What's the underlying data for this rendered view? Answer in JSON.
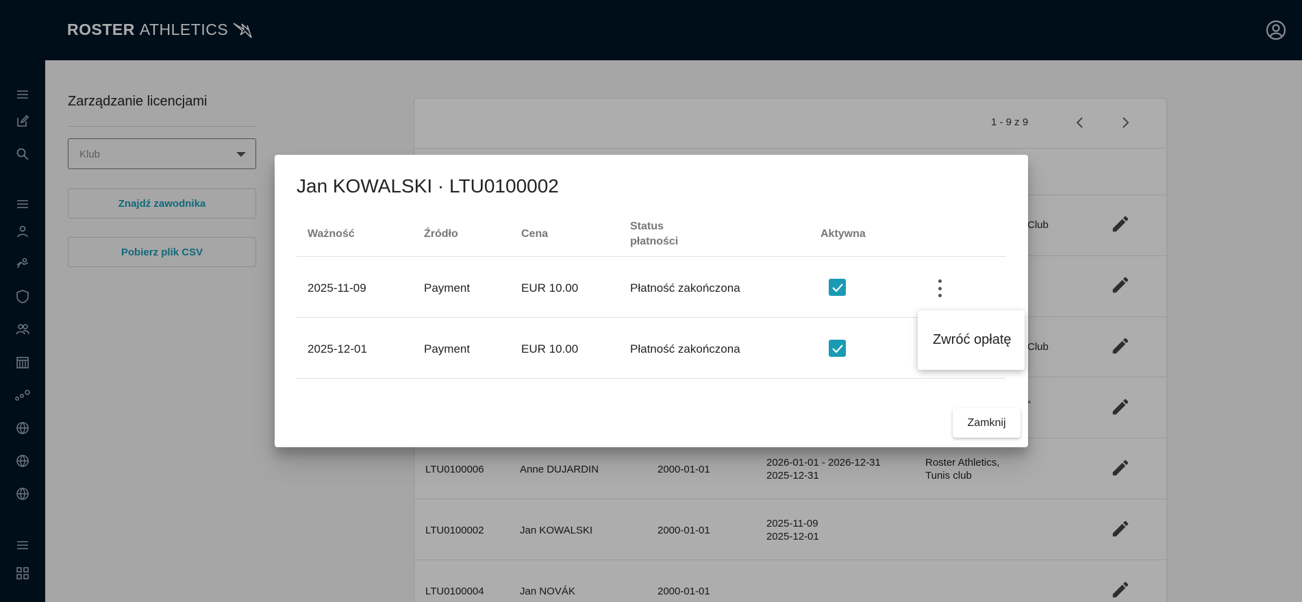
{
  "app": {
    "logo_bold": "ROSTER",
    "logo_light": "ATHLETICS",
    "account_icon": "account-circle-icon"
  },
  "rail": {
    "icons": [
      "menu-icon",
      "edit-icon",
      "search-icon",
      "menu-icon",
      "person-icon",
      "runner-icon",
      "shield-icon",
      "group-icon",
      "calendar-icon",
      "steps-icon",
      "globe-icon",
      "globe-icon",
      "globe-icon",
      "menu-icon",
      "grid-icon"
    ]
  },
  "panel": {
    "title": "Zarządzanie licencjami",
    "club_placeholder": "Klub",
    "find_button": "Znajdź zawodnika",
    "csv_button": "Pobierz plik CSV"
  },
  "pager": {
    "range": "1 - 9 z 9"
  },
  "background_table": {
    "rows": [
      {
        "id": "",
        "name": "",
        "birth": "",
        "validity_1": "",
        "validity_2": "",
        "club_1": "Club",
        "club_2": ""
      },
      {
        "id": "",
        "name": "",
        "birth": "",
        "validity_1": "",
        "validity_2": "",
        "club_1": "",
        "club_2": ""
      },
      {
        "id": "",
        "name": "",
        "birth": "",
        "validity_1": "",
        "validity_2": "",
        "club_1": "Club",
        "club_2": ""
      },
      {
        "id": "",
        "name": "",
        "birth": "",
        "validity_1": "",
        "validity_2": "",
        "club_1": "“",
        "club_2": ""
      },
      {
        "id": "LTU0100006",
        "name": "Anne DUJARDIN",
        "birth": "2000-01-01",
        "validity_1": "2026-01-01 - 2026-12-31",
        "validity_2": "2025-12-31",
        "club_1": "Roster Athletics,",
        "club_2": "Tunis club"
      },
      {
        "id": "LTU0100002",
        "name": "Jan KOWALSKI",
        "birth": "2000-01-01",
        "validity_1": "2025-11-09",
        "validity_2": "2025-12-01",
        "club_1": "",
        "club_2": ""
      },
      {
        "id": "LTU0100004",
        "name": "Jan NOVÁK",
        "birth": "2000-01-01",
        "validity_1": "",
        "validity_2": "",
        "club_1": "",
        "club_2": ""
      }
    ]
  },
  "dialog": {
    "title": "Jan KOWALSKI · LTU0100002",
    "headers": {
      "validity": "Ważność",
      "source": "Źródło",
      "price": "Cena",
      "status_line1": "Status",
      "status_line2": "płatności",
      "active": "Aktywna"
    },
    "rows": [
      {
        "validity": "2025-11-09",
        "source": "Payment",
        "price": "EUR 10.00",
        "status": "Płatność zakończona",
        "active": true
      },
      {
        "validity": "2025-12-01",
        "source": "Payment",
        "price": "EUR 10.00",
        "status": "Płatność zakończona",
        "active": true
      }
    ],
    "close_button": "Zamknij"
  },
  "context_menu": {
    "refund": "Zwróć opłatę"
  },
  "colors": {
    "nav": "#011627",
    "accent": "#1a9bb3"
  }
}
